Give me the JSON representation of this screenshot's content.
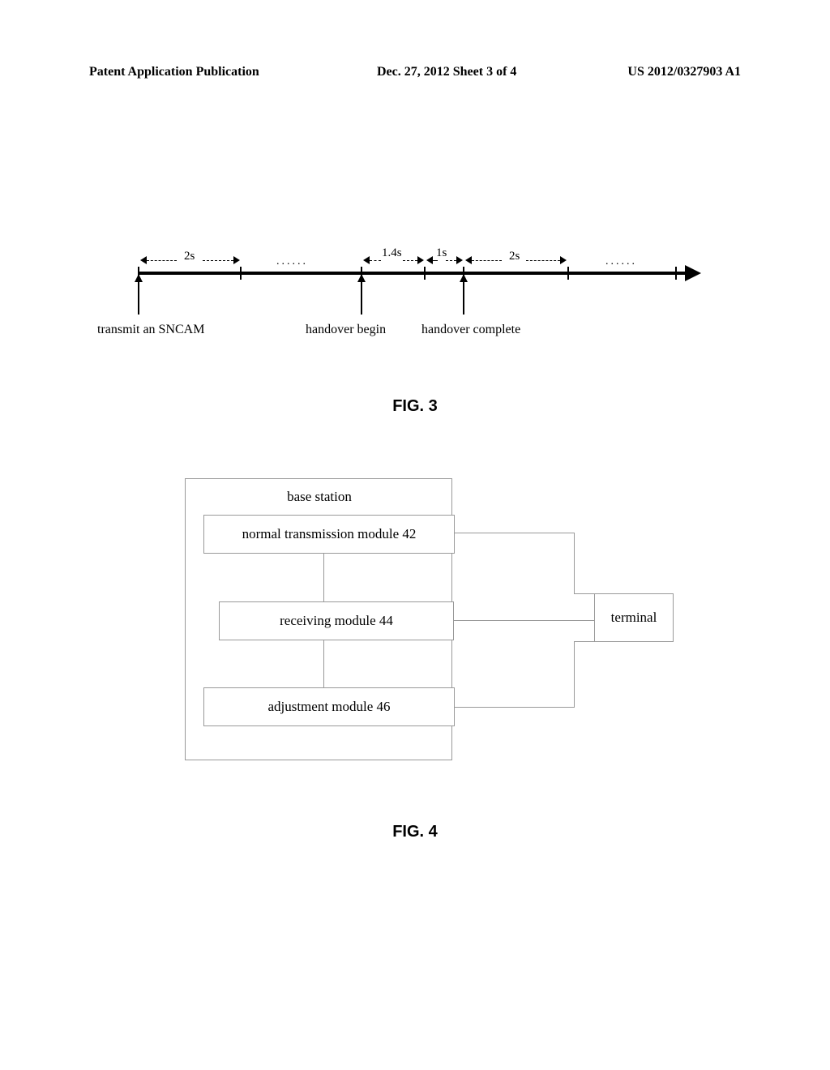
{
  "header": {
    "left": "Patent Application Publication",
    "center": "Dec. 27, 2012  Sheet 3 of 4",
    "right": "US 2012/0327903 A1"
  },
  "fig3": {
    "caption": "FIG. 3",
    "durations": {
      "d1": "2s",
      "d2": "1.4s",
      "d3": "1s",
      "d4": "2s"
    },
    "events": {
      "e1": "transmit an SNCAM",
      "e2": "handover begin",
      "e3": "handover complete"
    },
    "dots": "......"
  },
  "fig4": {
    "caption": "FIG. 4",
    "base_station": "base station",
    "modules": {
      "m42": "normal transmission module 42",
      "m44": "receiving module 44",
      "m46": "adjustment module 46"
    },
    "terminal": "terminal"
  }
}
